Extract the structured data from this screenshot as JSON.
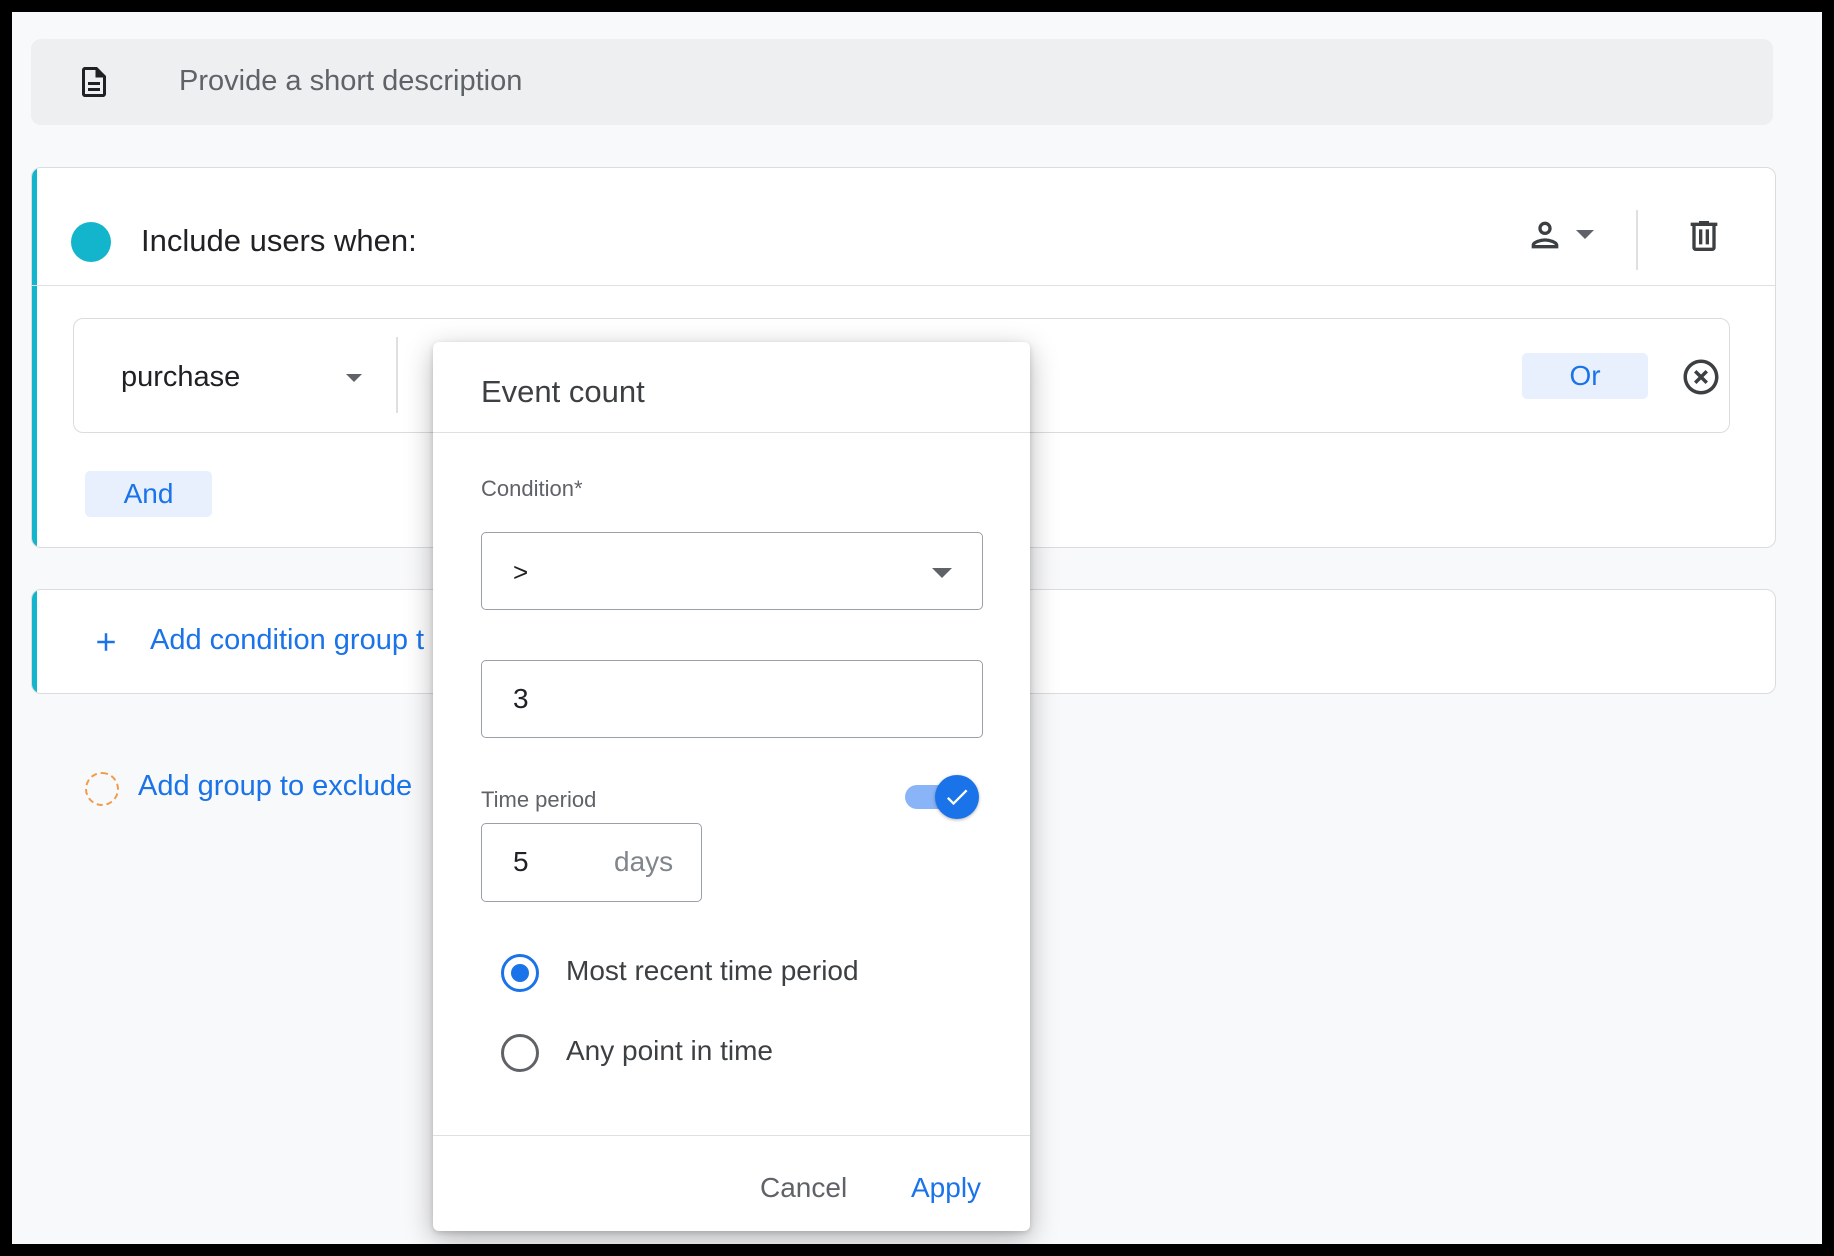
{
  "description": {
    "placeholder": "Provide a short description",
    "icon": "document-icon"
  },
  "include_group": {
    "title": "Include users when:",
    "accent_color": "#12b5cb",
    "scope_icon": "person-icon",
    "delete_icon": "trash-icon",
    "condition": {
      "event": "purchase",
      "or_label": "Or",
      "remove_icon": "close-circle-icon"
    },
    "and_label": "And"
  },
  "add_condition_group": {
    "label": "Add condition group t",
    "icon": "plus-icon"
  },
  "exclude_group": {
    "label": "Add group to exclude",
    "icon": "dashed-circle-icon"
  },
  "popup": {
    "title": "Event count",
    "condition_label": "Condition*",
    "condition_value": ">",
    "count_value": "3",
    "time_period_label": "Time period",
    "time_period_enabled": true,
    "days_value": "5",
    "days_suffix": "days",
    "radio_options": [
      {
        "label": "Most recent time period",
        "checked": true
      },
      {
        "label": "Any point in time",
        "checked": false
      }
    ],
    "cancel_label": "Cancel",
    "apply_label": "Apply"
  },
  "colors": {
    "accent_blue": "#1a73e8",
    "teal": "#12b5cb",
    "exclude_orange": "#f29b4b"
  }
}
